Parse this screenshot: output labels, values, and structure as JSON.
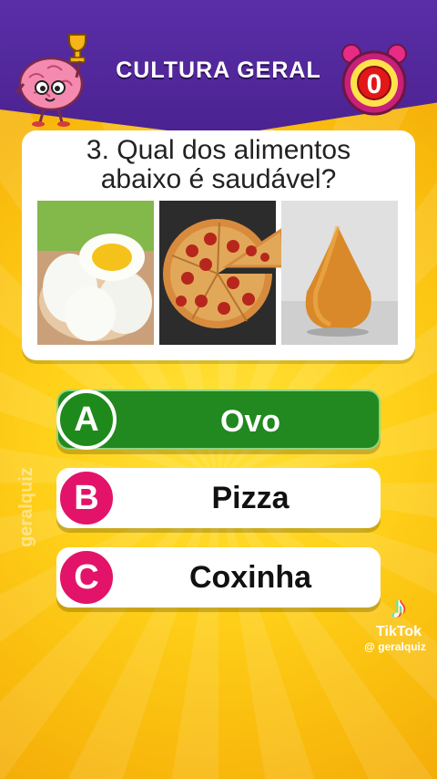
{
  "header": {
    "title": "CULTURA GERAL"
  },
  "timer": {
    "value": "0"
  },
  "question": {
    "line1": "3. Qual dos alimentos",
    "line2": "abaixo é saudável?"
  },
  "images": [
    {
      "name": "boiled-eggs-image"
    },
    {
      "name": "pepperoni-pizza-image"
    },
    {
      "name": "coxinha-image"
    }
  ],
  "options": [
    {
      "letter": "A",
      "label": "Ovo",
      "state": "correct",
      "color": "#21891f"
    },
    {
      "letter": "B",
      "label": "Pizza",
      "state": "default",
      "color": "#e3136a"
    },
    {
      "letter": "C",
      "label": "Coxinha",
      "state": "default",
      "color": "#e3136a"
    }
  ],
  "watermark": "geralquiz",
  "tiktok": {
    "icon": "tiktok-logo-icon",
    "brand": "TikTok",
    "handle": "@ geralquiz"
  }
}
